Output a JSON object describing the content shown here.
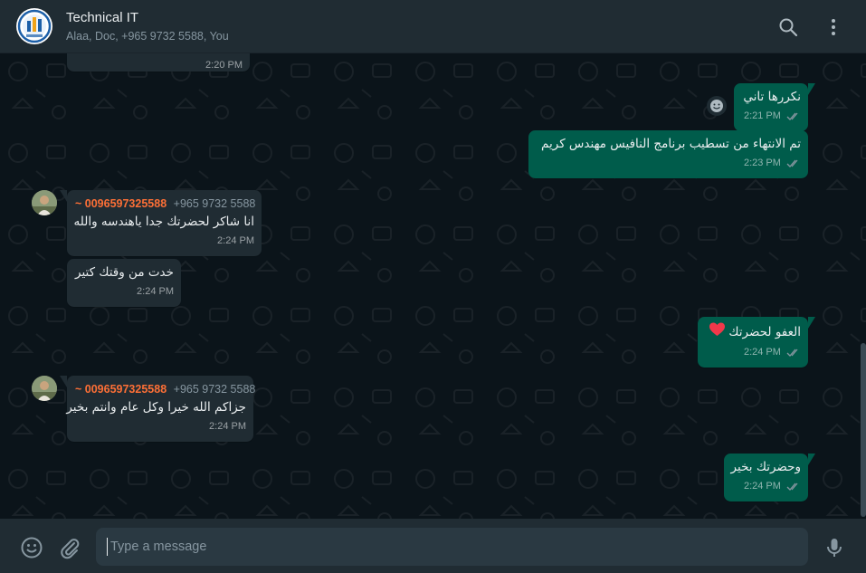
{
  "header": {
    "title": "Technical IT",
    "subtitle": "Alaa, Doc, +965 9732 5588, You",
    "icons": [
      "search-icon",
      "menu-icon"
    ]
  },
  "messages": [
    {
      "direction": "in",
      "time": "2:20 PM"
    },
    {
      "direction": "out",
      "text": "نكررها تاني",
      "time": "2:21 PM"
    },
    {
      "direction": "out",
      "text": "تم الانتهاء من تسطيب برنامج النافيس مهندس كريم",
      "time": "2:23 PM"
    },
    {
      "direction": "in",
      "sender": "~ 0096597325588",
      "phone": "+965 9732 5588",
      "text": "انا شاكر لحضرتك جدا ياهندسه والله",
      "time": "2:24 PM"
    },
    {
      "direction": "in",
      "text": "خدت من وقتك كتير",
      "time": "2:24 PM"
    },
    {
      "direction": "out",
      "text": "العفو لحضرتك",
      "emoji": "❤️",
      "time": "2:24 PM"
    },
    {
      "direction": "in",
      "sender": "~ 0096597325588",
      "phone": "+965 9732 5588",
      "text": "جزاكم الله خيرا وكل عام وانتم بخير",
      "time": "2:24 PM"
    },
    {
      "direction": "out",
      "text": "وحضرتك بخير",
      "time": "2:24 PM"
    }
  ],
  "composer": {
    "placeholder": "Type a message",
    "icons": [
      "emoji-icon",
      "attach-icon",
      "mic-icon"
    ]
  },
  "colors": {
    "header_bg": "#202c33",
    "chat_bg": "#0b141a",
    "incoming_bubble": "#202c33",
    "outgoing_bubble": "#005c4b",
    "sender_name": "#fc6f36",
    "ticks": "#8696a0"
  }
}
